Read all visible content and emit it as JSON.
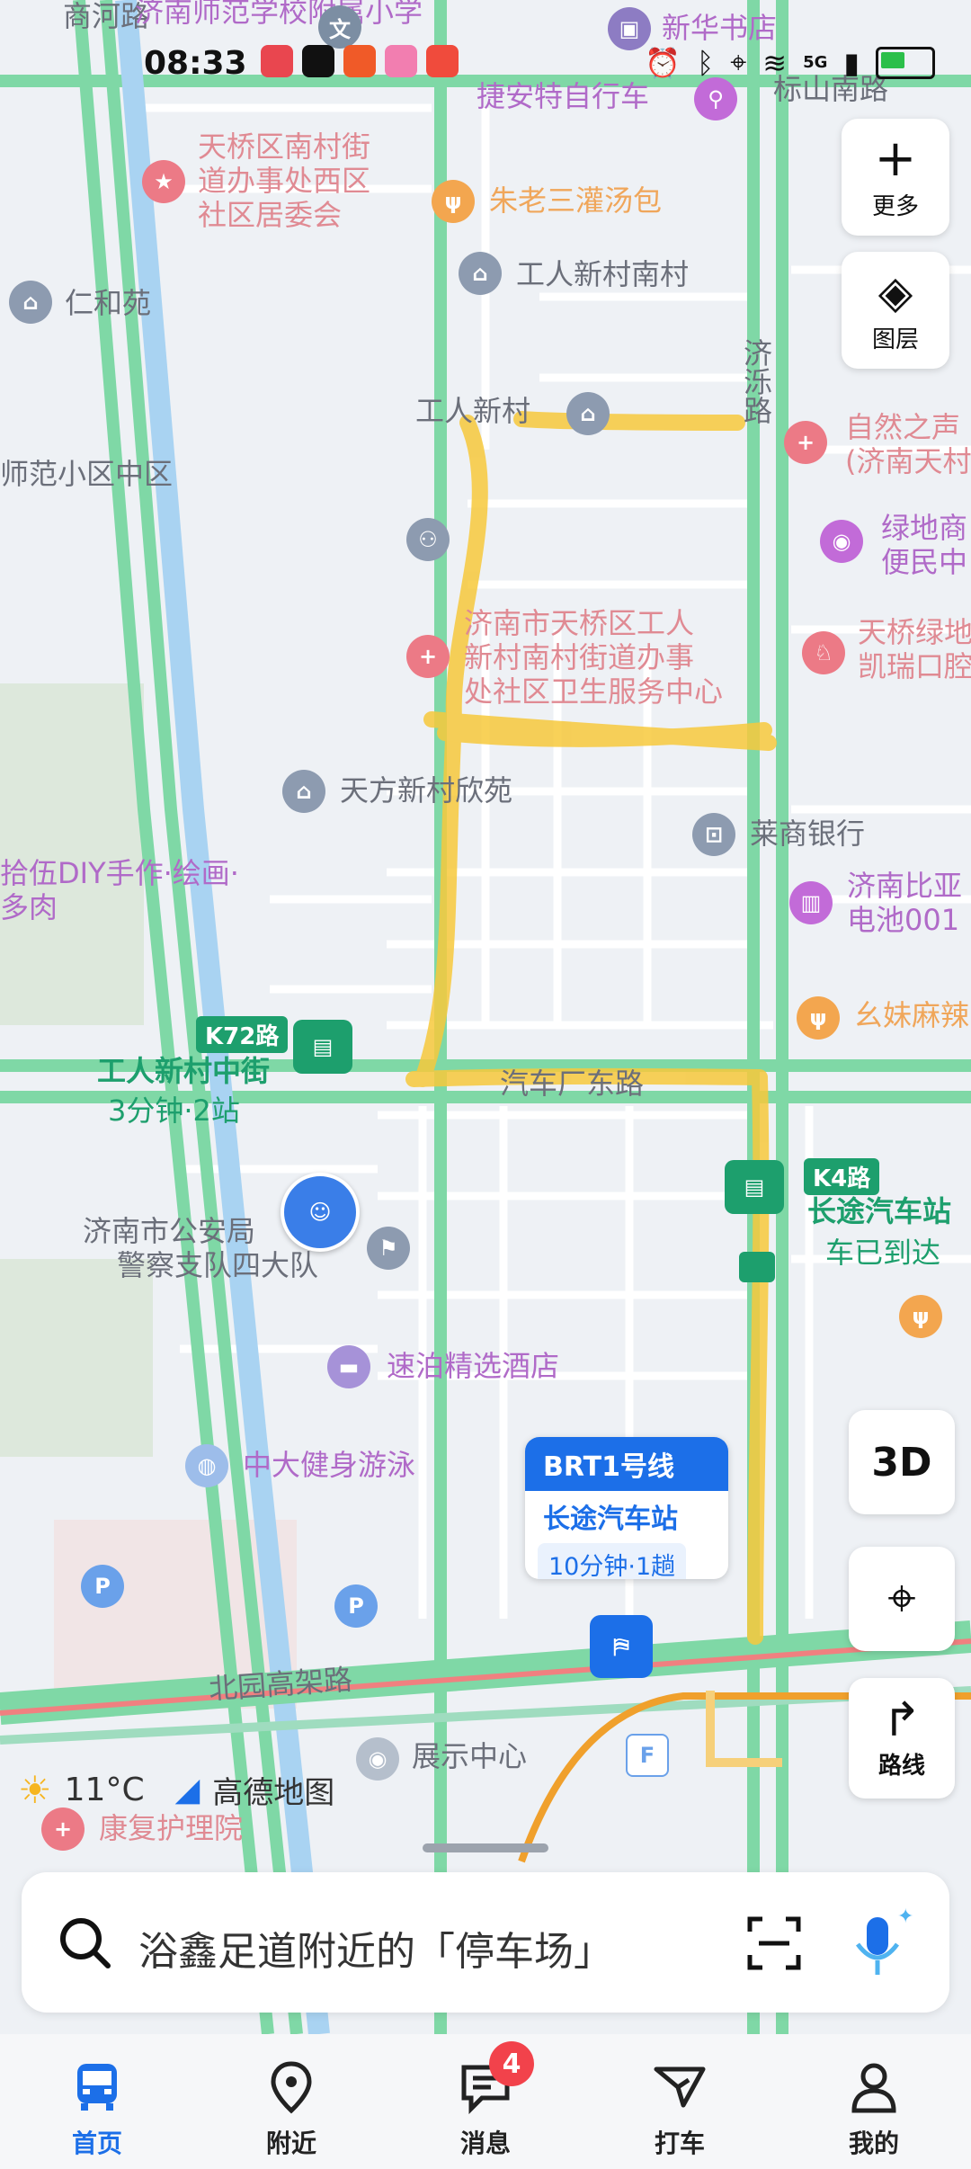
{
  "status_bar": {
    "time": "08:33",
    "network": "5G"
  },
  "map": {
    "roads": {
      "north_garden_expressway": "北园高架路",
      "jiluo_road": "济泺路",
      "gongren_new_village": "工人新村",
      "bus_factory_east_road": "汽车厂东路",
      "shang_river_road": "商河路",
      "biaoshan_south_road": "标山南路"
    },
    "pois": {
      "jinan_normal_school": "济南师范学校附属小学",
      "xinhua_bookstore": "新华书店",
      "giant_bike": "捷安特自行车",
      "tianqiao_office_line1": "天桥区南村街",
      "tianqiao_office_line2": "道办事处西区",
      "tianqiao_office_line3": "社区居委会",
      "zhu_soup": "朱老三灌汤包",
      "gongren_south_village": "工人新村南村",
      "renhe_yuan": "仁和苑",
      "normal_community": "师范小区中区",
      "nature_voice_line1": "自然之声",
      "nature_voice_line2": "(济南天村",
      "greenland_line1": "绿地商",
      "greenland_line2": "便民中",
      "health_center_line1": "济南市天桥区工人",
      "health_center_line2": "新村南村街道办事",
      "health_center_line3": "处社区卫生服务中心",
      "dental_line1": "天桥绿地",
      "dental_line2": "凯瑞口腔",
      "tianfang_xinyuan": "天方新村欣苑",
      "laishang_bank": "莱商银行",
      "diy_line1": "拾伍DIY手作·绘画·",
      "diy_line2": "多肉",
      "byd_line1": "济南比亚",
      "byd_line2": "电池001",
      "yaomei_noodles": "幺妹麻辣",
      "police_line1": "济南市公安局",
      "police_line2": "警察支队四大队",
      "suibo_hotel": "速泊精选酒店",
      "zhongda_gym": "中大健身游泳",
      "exhibition_center": "展示中心",
      "rehab_hospital": "康复护理院",
      "wen_icon_text": "文"
    },
    "bus_stops": [
      {
        "route": "K72路",
        "stop": "工人新村中街",
        "eta": "3分钟·2站"
      },
      {
        "route": "K4路",
        "stop": "长途汽车站",
        "eta": "车已到达"
      }
    ],
    "brt_card": {
      "line": "BRT1号线",
      "stop": "长途汽车站",
      "eta": "10分钟·1趟"
    },
    "weather": {
      "temp": "11°C"
    },
    "brand": "高德地图",
    "parking_letter": "P",
    "floor_letter": "F"
  },
  "controls": {
    "more": "更多",
    "layers": "图层",
    "three_d": "3D",
    "route": "路线"
  },
  "search": {
    "placeholder": "浴鑫足道附近的「停车场」"
  },
  "tabbar": {
    "tabs": [
      {
        "label": "首页",
        "active": true
      },
      {
        "label": "附近",
        "active": false
      },
      {
        "label": "消息",
        "active": false,
        "badge": "4"
      },
      {
        "label": "打车",
        "active": false
      },
      {
        "label": "我的",
        "active": false
      }
    ]
  },
  "colors": {
    "accent": "#1c6fe8",
    "road_green": "#7fd8a6",
    "highlight": "#f7c93c",
    "badge": "#f2424b"
  }
}
